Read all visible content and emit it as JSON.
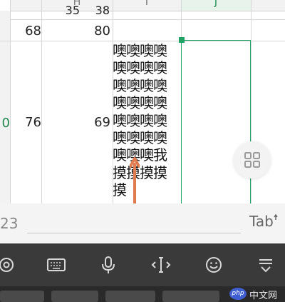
{
  "spreadsheet": {
    "columns": [
      "H",
      "I",
      "J"
    ],
    "selected_column": "J",
    "selected_row_label": "0",
    "top_partial_values": [
      "35",
      "38"
    ],
    "row_68": {
      "g": "68",
      "h": "80"
    },
    "row_selected": {
      "g": "76",
      "h": "69"
    },
    "wrapped_cell_lines": [
      "噢噢噢噢",
      "噢噢噢噢",
      "噢噢噢噢",
      "噢噢噢噢",
      "噢噢噢噢",
      "噢噢噢噢",
      "噢噢噢我",
      "摸摸摸摸",
      "摸"
    ]
  },
  "input_bar": {
    "value": "23",
    "tab_label": "Tab"
  },
  "keyboard_toolbar": {
    "icons": [
      "gear-icon",
      "keyboard-icon",
      "microphone-icon",
      "text-cursor-icon",
      "emoji-icon",
      "collapse-keyboard-icon"
    ]
  },
  "watermark": {
    "logo_text": "php",
    "text": "中文网"
  },
  "colors": {
    "accent": "#21a366",
    "arrow": "#e07a4f",
    "keyboard_bg": "#3a3a3a"
  }
}
